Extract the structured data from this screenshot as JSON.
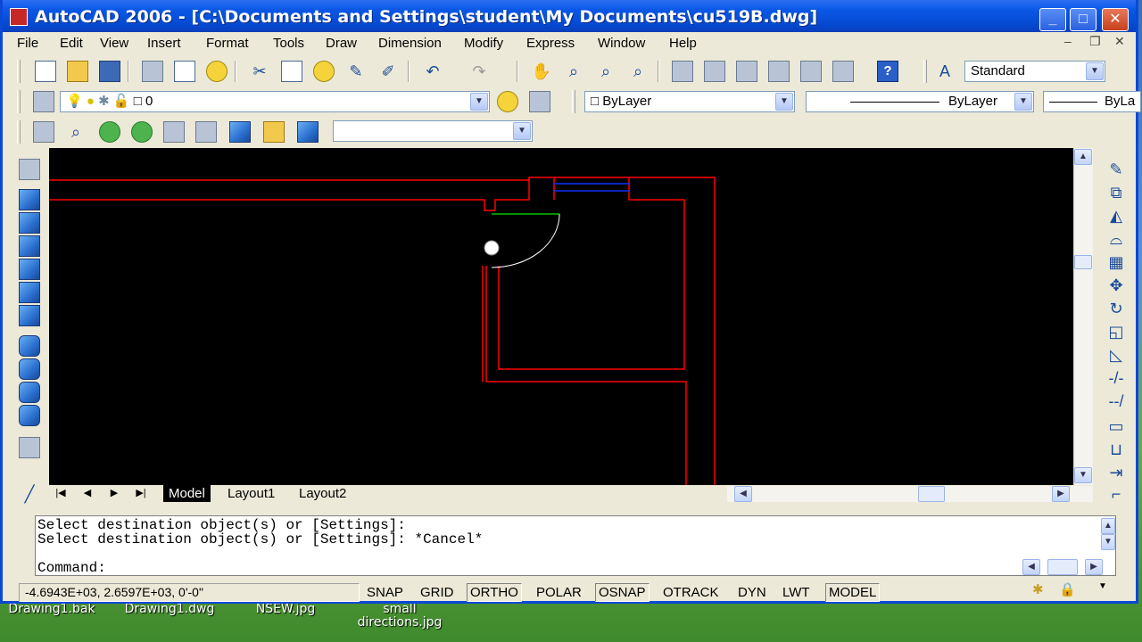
{
  "window": {
    "title": "AutoCAD 2006 - [C:\\Documents and Settings\\student\\My Documents\\cu519B.dwg]",
    "minimize_glyph": "_",
    "maximize_glyph": "□",
    "close_glyph": "✕"
  },
  "menubar": {
    "items": [
      "File",
      "Edit",
      "View",
      "Insert",
      "Format",
      "Tools",
      "Draw",
      "Dimension",
      "Modify",
      "Express",
      "Window",
      "Help"
    ],
    "doc_controls": [
      "–",
      "❐",
      "✕"
    ]
  },
  "toolbars": {
    "text_style": "Standard",
    "layer": "0",
    "color": "ByLayer",
    "linetype": "ByLayer",
    "lineweight": "ByLa",
    "empty_combo": ""
  },
  "layout_tabs": [
    "Model",
    "Layout1",
    "Layout2"
  ],
  "command_window": {
    "lines": [
      "Select destination object(s) or [Settings]:",
      "Select destination object(s) or [Settings]: *Cancel*"
    ],
    "prompt": "Command:",
    "input_value": ""
  },
  "status_bar": {
    "coordinates": "-4.6943E+03, 2.6597E+03, 0'-0\"",
    "toggles": [
      {
        "label": "SNAP",
        "on": false
      },
      {
        "label": "GRID",
        "on": false
      },
      {
        "label": "ORTHO",
        "on": true
      },
      {
        "label": "POLAR",
        "on": false
      },
      {
        "label": "OSNAP",
        "on": true
      },
      {
        "label": "OTRACK",
        "on": false
      },
      {
        "label": "DYN",
        "on": false
      },
      {
        "label": "LWT",
        "on": false
      },
      {
        "label": "MODEL",
        "on": true
      }
    ]
  },
  "desktop_icons": [
    {
      "label": "Drawing1.bak"
    },
    {
      "label": "Drawing1.dwg"
    },
    {
      "label": "NSEW.jpg"
    },
    {
      "label": "small\ndirections.jpg"
    }
  ],
  "colors": {
    "title_bar": "#0548d0",
    "canvas_background": "#000000",
    "wall_lines": "#ff0000",
    "door_swing": "#ffffff",
    "door_jamb": "#00c000",
    "window_lines": "#1030ff"
  },
  "icons": {
    "left_toolbar": [
      "ucs-icon",
      "cube-front-icon",
      "cube-top-icon",
      "cube-left-icon",
      "cube-right-icon",
      "cube-back-icon",
      "cube-bottom-icon",
      "iso-sw-icon",
      "iso-se-icon",
      "iso-ne-icon",
      "iso-nw-icon",
      "camera-icon",
      "line-icon"
    ],
    "right_toolbar": [
      "erase-icon",
      "copy-icon",
      "mirror-icon",
      "offset-icon",
      "array-icon",
      "move-icon",
      "rotate-icon",
      "scale-icon",
      "stretch-icon",
      "trim-icon",
      "extend-icon",
      "break-icon",
      "join-icon",
      "chamfer-icon",
      "fillet-icon"
    ]
  }
}
